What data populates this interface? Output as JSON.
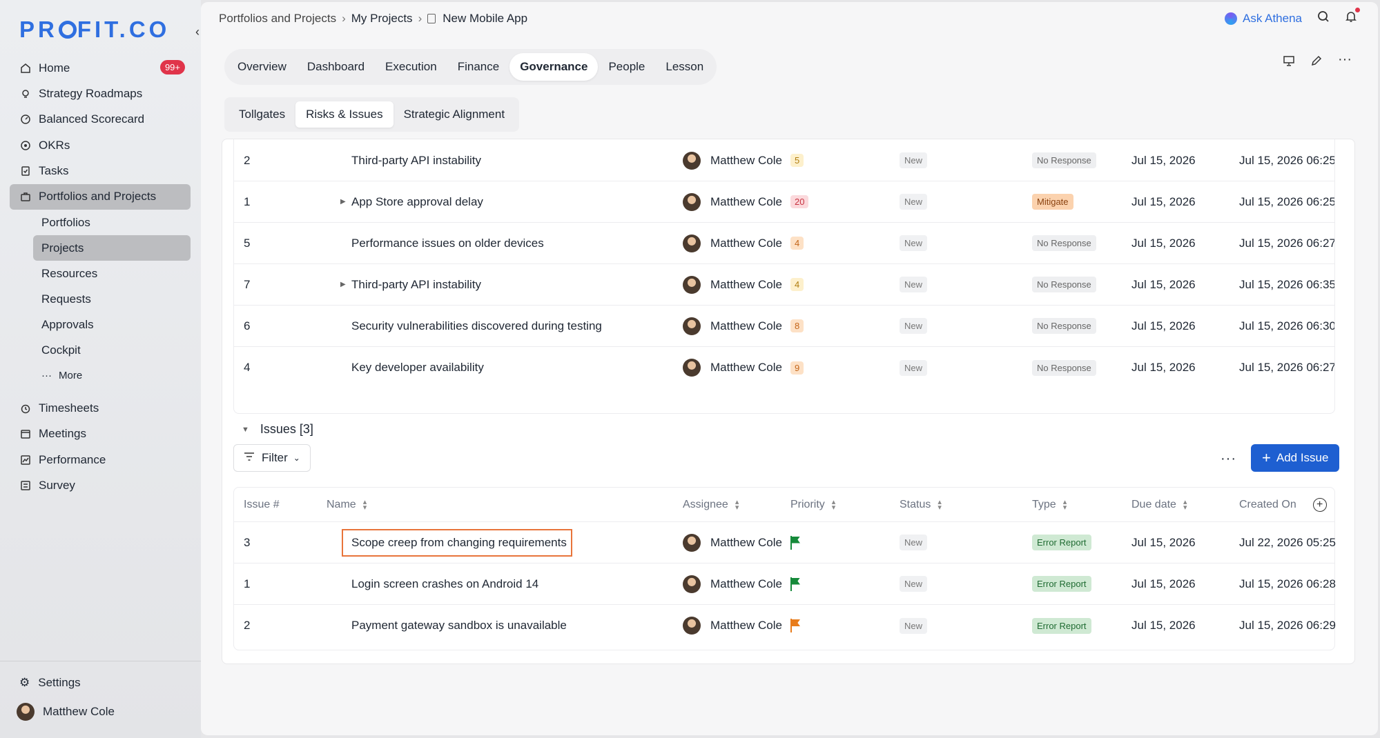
{
  "app": {
    "logo_text": "PROFIT.CO"
  },
  "sidebar": {
    "items": [
      {
        "label": "Home",
        "badge": "99+"
      },
      {
        "label": "Strategy Roadmaps"
      },
      {
        "label": "Balanced Scorecard"
      },
      {
        "label": "OKRs"
      },
      {
        "label": "Tasks"
      },
      {
        "label": "Portfolios and Projects"
      }
    ],
    "sub_items": [
      "Portfolios",
      "Projects",
      "Resources",
      "Requests",
      "Approvals",
      "Cockpit"
    ],
    "more_label": "More",
    "items_after": [
      "Timesheets",
      "Meetings",
      "Performance",
      "Survey"
    ],
    "settings_label": "Settings",
    "user_name": "Matthew Cole"
  },
  "breadcrumb": {
    "level1": "Portfolios and Projects",
    "level2": "My Projects",
    "current": "New Mobile App"
  },
  "top": {
    "ask_label": "Ask Athena"
  },
  "tabs": [
    "Overview",
    "Dashboard",
    "Execution",
    "Finance",
    "Governance",
    "People",
    "Lesson"
  ],
  "subtabs": [
    "Tollgates",
    "Risks & Issues",
    "Strategic Alignment"
  ],
  "risks": {
    "rows": [
      {
        "num": "2",
        "name": "Third-party API instability",
        "assignee": "Matthew Cole",
        "level": "5",
        "status": "New",
        "response": "No Response",
        "due": "Jul 15, 2026",
        "created": "Jul 15, 2026 06:25"
      },
      {
        "num": "1",
        "name": "App Store approval delay",
        "assignee": "Matthew Cole",
        "level": "20",
        "status": "New",
        "response": "Mitigate",
        "due": "Jul 15, 2026",
        "created": "Jul 15, 2026 06:25"
      },
      {
        "num": "5",
        "name": "Performance issues on older devices",
        "assignee": "Matthew Cole",
        "level": "4",
        "status": "New",
        "response": "No Response",
        "due": "Jul 15, 2026",
        "created": "Jul 15, 2026 06:27"
      },
      {
        "num": "7",
        "name": "Third-party API instability",
        "assignee": "Matthew Cole",
        "level": "4",
        "status": "New",
        "response": "No Response",
        "due": "Jul 15, 2026",
        "created": "Jul 15, 2026 06:35"
      },
      {
        "num": "6",
        "name": "Security vulnerabilities discovered during testing",
        "assignee": "Matthew Cole",
        "level": "8",
        "status": "New",
        "response": "No Response",
        "due": "Jul 15, 2026",
        "created": "Jul 15, 2026 06:30"
      },
      {
        "num": "4",
        "name": "Key developer availability",
        "assignee": "Matthew Cole",
        "level": "9",
        "status": "New",
        "response": "No Response",
        "due": "Jul 15, 2026",
        "created": "Jul 15, 2026 06:27"
      }
    ]
  },
  "issues": {
    "section_label": "Issues [3]",
    "filter_label": "Filter",
    "add_label": "Add Issue",
    "headers": {
      "num": "Issue #",
      "name": "Name",
      "assignee": "Assignee",
      "priority": "Priority",
      "status": "Status",
      "type": "Type",
      "due": "Due date",
      "created": "Created On"
    },
    "rows": [
      {
        "num": "3",
        "name": "Scope creep from changing requirements",
        "assignee": "Matthew Cole",
        "priority_color": "#168a3a",
        "status": "New",
        "type": "Error Report",
        "due": "Jul 15, 2026",
        "created": "Jul 22, 2026 05:25"
      },
      {
        "num": "1",
        "name": "Login screen crashes on Android 14",
        "assignee": "Matthew Cole",
        "priority_color": "#168a3a",
        "status": "New",
        "type": "Error Report",
        "due": "Jul 15, 2026",
        "created": "Jul 15, 2026 06:28"
      },
      {
        "num": "2",
        "name": "Payment gateway sandbox is unavailable",
        "assignee": "Matthew Cole",
        "priority_color": "#e87c1c",
        "status": "New",
        "type": "Error Report",
        "due": "Jul 15, 2026",
        "created": "Jul 15, 2026 06:29"
      }
    ]
  }
}
